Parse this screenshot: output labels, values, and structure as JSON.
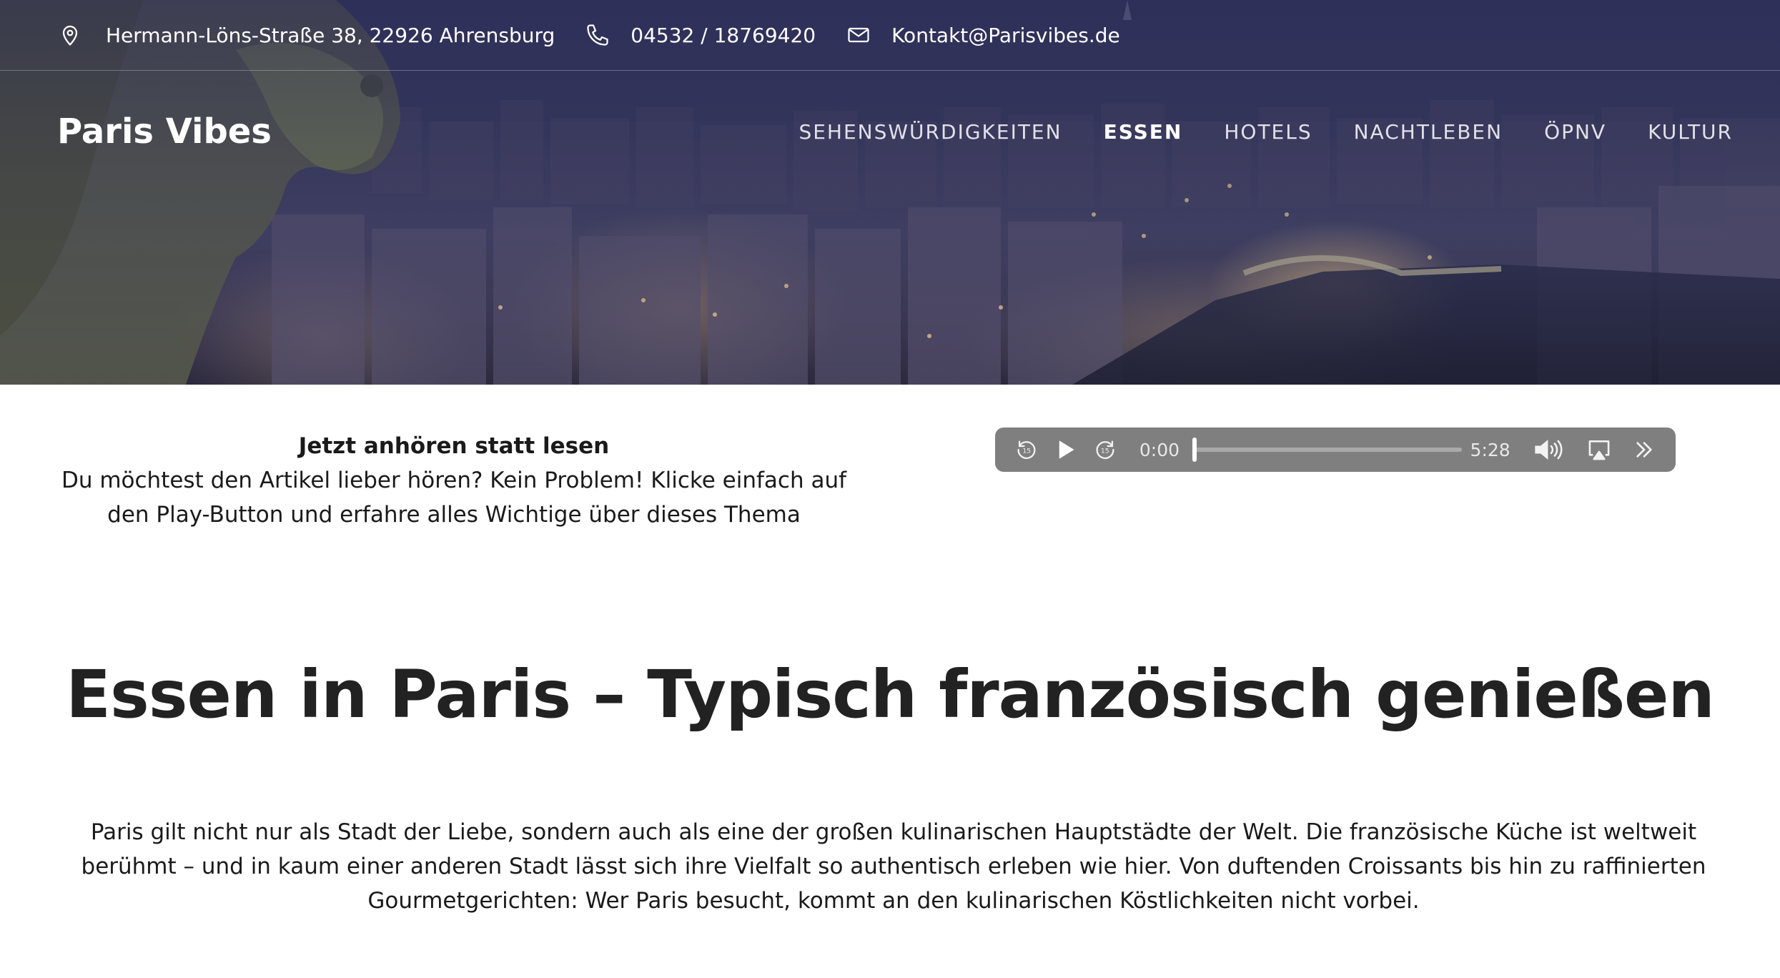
{
  "topbar": {
    "address": "Hermann-Löns-Straße 38, 22926 Ahrensburg",
    "phone": "04532 / 18769420",
    "email": "Kontakt@Parisvibes.de",
    "icons": [
      "map-pin-icon",
      "phone-icon",
      "mail-icon"
    ]
  },
  "header": {
    "logo": "Paris Vibes",
    "nav": [
      {
        "label": "SEHENSWÜRDIGKEITEN",
        "active": false
      },
      {
        "label": "ESSEN",
        "active": true
      },
      {
        "label": "HOTELS",
        "active": false
      },
      {
        "label": "NACHTLEBEN",
        "active": false
      },
      {
        "label": "ÖPNV",
        "active": false
      },
      {
        "label": "KULTUR",
        "active": false
      }
    ]
  },
  "audio": {
    "title": "Jetzt anhören statt lesen",
    "description": "Du möchtest den Artikel lieber hören? Kein Problem! Klicke einfach auf den Play-Button und erfahre alles Wichtige über dieses Thema",
    "player": {
      "current_time": "0:00",
      "duration": "5:28",
      "skip_back_seconds": "15",
      "skip_forward_seconds": "15",
      "progress": 0
    }
  },
  "article": {
    "title": "Essen in Paris – Typisch französisch genießen",
    "intro": "Paris gilt nicht nur als Stadt der Liebe, sondern auch als eine der großen kulinarischen Hauptstädte der Welt. Die französische Küche ist weltweit berühmt – und in kaum einer anderen Stadt lässt sich ihre Vielfalt so authentisch erleben wie hier. Von duftenden Croissants bis hin zu raffinierten Gourmetgerichten: Wer Paris besucht, kommt an den kulinarischen Köstlichkeiten nicht vorbei."
  },
  "colors": {
    "hero_tint": "#3a3c63",
    "player_bg": "#7f7f7f",
    "heading": "#222222",
    "text": "#1a1a1a"
  }
}
